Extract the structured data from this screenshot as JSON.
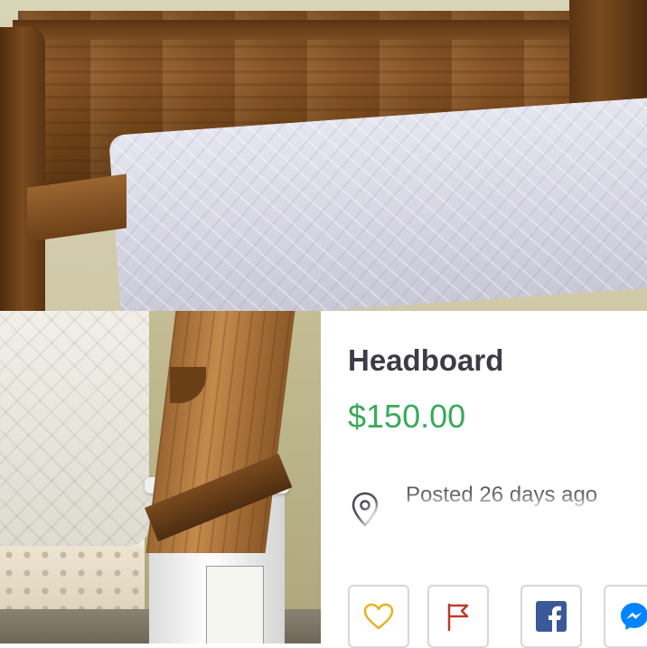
{
  "listing": {
    "title": "Headboard",
    "price": "$150.00",
    "posted": "Posted 26 days ago"
  },
  "photos": [
    {
      "subject": "wooden pew headboard behind bed"
    },
    {
      "subject": "pew leg resting on white bucket"
    }
  ],
  "actions": [
    {
      "icon": "heart-icon",
      "color": "#e8b21f"
    },
    {
      "icon": "flag-icon",
      "color": "#c0392b"
    },
    {
      "icon": "facebook-icon",
      "color": "#3b5998"
    },
    {
      "icon": "messenger-icon",
      "color": "#0084ff"
    }
  ],
  "colors": {
    "price": "#3aaa5b",
    "title": "#3b3c46",
    "muted_text": "#5c5d66"
  }
}
